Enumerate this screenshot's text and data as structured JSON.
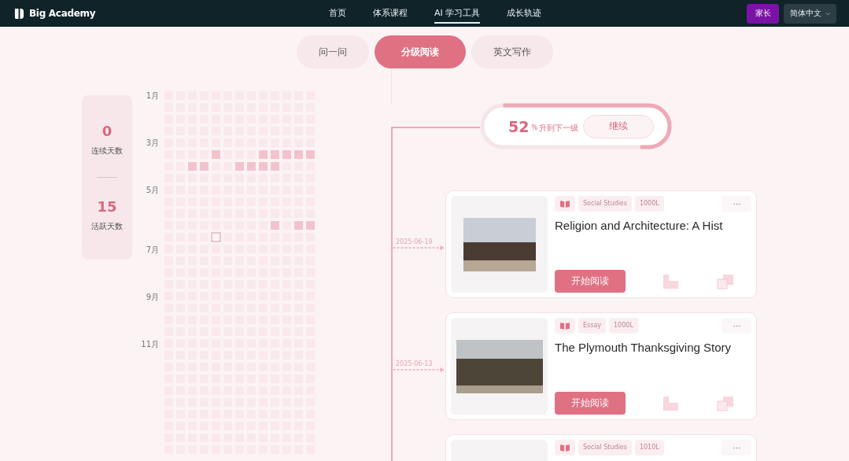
{
  "nav": {
    "brand": "Big Academy",
    "items": [
      {
        "label": "首页",
        "selected": false
      },
      {
        "label": "体系课程",
        "selected": false
      },
      {
        "label": "AI 学习工具",
        "selected": true
      },
      {
        "label": "成长轨迹",
        "selected": false
      }
    ],
    "parent_button": "家长",
    "language": "简体中文"
  },
  "tabs": [
    {
      "label": "问一问",
      "selected": false
    },
    {
      "label": "分级阅读",
      "selected": true
    },
    {
      "label": "英文写作",
      "selected": false
    }
  ],
  "stats": [
    {
      "value": "0",
      "label": "连续天数"
    },
    {
      "value": "15",
      "label": "活跃天数"
    }
  ],
  "calendar": {
    "months": [
      "1月",
      "3月",
      "5月",
      "7月",
      "9月",
      "11月"
    ]
  },
  "progress": {
    "value": "52",
    "unit": "%",
    "label": "升到下一级",
    "button": "继续"
  },
  "readings": [
    {
      "date": "2025-06-19",
      "tags": [
        "Social Studies",
        "1000L"
      ],
      "title": "Religion and Architecture: A Hist",
      "button": "开始阅读"
    },
    {
      "date": "2025-06-13",
      "tags": [
        "Essay",
        "1000L"
      ],
      "title": "The Plymouth Thanksgiving Story",
      "button": "开始阅读"
    },
    {
      "tags": [
        "Social Studies",
        "1010L"
      ]
    }
  ]
}
